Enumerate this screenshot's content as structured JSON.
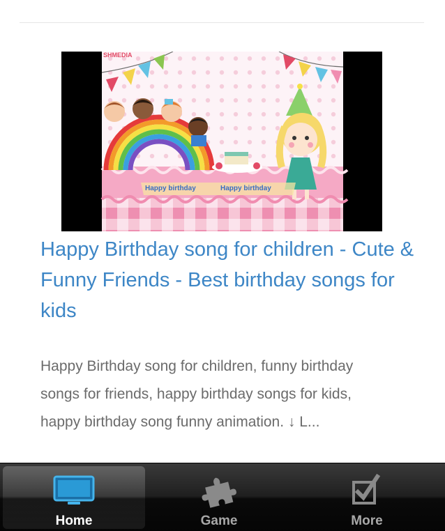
{
  "post": {
    "thumbnail_watermark": "SHMEDIA",
    "thumbnail_caption_1": "Happy birthday",
    "thumbnail_caption_2": "Happy birthday",
    "title": "Happy Birthday song for children - Cute & Funny Friends - Best birthday songs for kids",
    "excerpt": "Happy Birthday song for children, funny birthday songs for friends, happy birthday songs for kids, happy birthday song funny animation. ↓ L..."
  },
  "tabbar": {
    "tabs": [
      {
        "label": "Home",
        "icon": "tv-icon",
        "active": true
      },
      {
        "label": "Game",
        "icon": "puzzle-icon",
        "active": false
      },
      {
        "label": "More",
        "icon": "checkbox-icon",
        "active": false
      }
    ]
  },
  "colors": {
    "title_link": "#3d86c6",
    "excerpt_text": "#6b6b6b",
    "tab_active_icon": "#3aa7e0",
    "tabbar_bg": "#1f1f1f"
  }
}
